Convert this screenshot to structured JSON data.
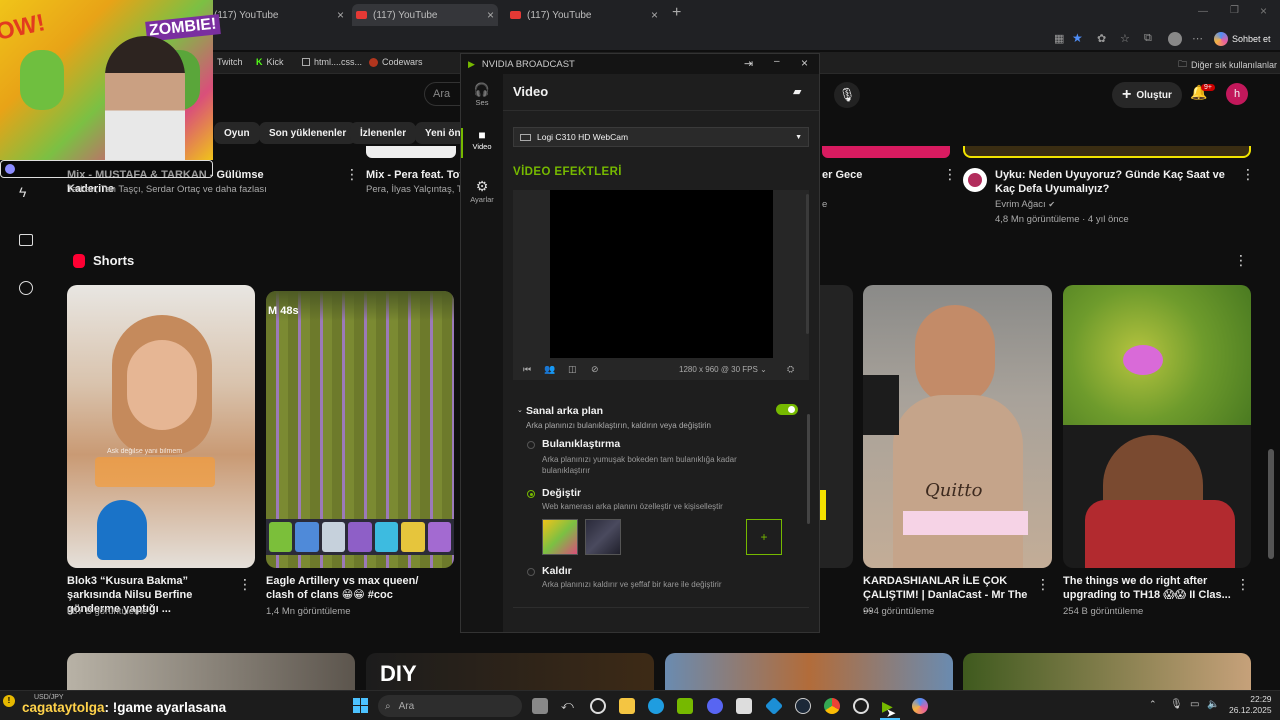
{
  "browser": {
    "tabs": [
      {
        "label": "(117) YouTube"
      },
      {
        "label": "(117) YouTube"
      },
      {
        "label": "(117) YouTube"
      }
    ],
    "new_tab": "+",
    "chat_label": "Sohbet et",
    "other_bookmarks": "Diğer sık kullanılanlar",
    "bookmarks": [
      "Twitch",
      "Kick",
      "html....css...",
      "Codewars"
    ]
  },
  "youtube": {
    "search_placeholder": "Ara",
    "create_label": "Oluştur",
    "notif_count": "9+",
    "avatar_letter": "h",
    "chips": [
      "Oyun",
      "Son yüklenenler",
      "İzlenenler",
      "Yeni öne"
    ],
    "top_videos": [
      {
        "title": "Mix - MUSTAFA & TARKAN - Gülümse Kaderine",
        "meta": "Tarkan, Tan Taşçı, Serdar Ortaç ve daha fazlası"
      },
      {
        "title": "Mix - Pera feat. Toy",
        "meta": "Pera, İlyas Yalçıntaş, To"
      },
      {
        "title": "er Gece",
        "meta": "e"
      },
      {
        "title": "Uyku: Neden Uyuyoruz? Günde Kaç Saat ve Kaç Defa Uyumalıyız?",
        "channel": "Evrim Ağacı",
        "meta": "4,8 Mn görüntüleme · 4 yıl önce"
      }
    ],
    "shorts_label": "Shorts",
    "shorts": [
      {
        "title": "Blok3 “Kusura Bakma” şarkısında Nilsu Berfine gönderme yaptığı ...",
        "views": "887 B görüntüleme",
        "caption": "Ask değilse yani bilmem"
      },
      {
        "title": "Eagle Artillery vs max queen/ clash of clans 😁😁 #coc",
        "views": "1,4 Mn görüntüleme",
        "timer": "M 48s"
      },
      {
        "title": "KARDASHIANLAR İLE ÇOK ÇALIŞTIM! | DanlaCast - Mr The ...",
        "views": "994 görüntüleme",
        "shirt": "Quitto"
      },
      {
        "title": "The things we do right after upgrading to TH18 😱😱 II Clas...",
        "views": "254 B görüntüleme"
      }
    ],
    "bottom_row": [
      "DIY"
    ]
  },
  "nvidia": {
    "app_title": "NVIDIA BROADCAST",
    "sidebar": [
      {
        "label": "Ses",
        "icon": "headset-icon"
      },
      {
        "label": "Video",
        "icon": "camera-icon"
      },
      {
        "label": "Ayarlar",
        "icon": "gear-icon"
      }
    ],
    "page_title": "Video",
    "camera_device": "Logi C310 HD WebCam",
    "effects_heading": "VİDEO EFEKTLERİ",
    "resolution": "1280 x 960 @ 30 FPS",
    "virtual_bg": {
      "title": "Sanal arka plan",
      "desc": "Arka planınızı bulanıklaştırın, kaldırın veya değiştirin",
      "enabled": true,
      "options": [
        {
          "label": "Bulanıklaştırma",
          "desc": "Arka planınızı yumuşak bokeden tam bulanıklığa kadar bulanıklaştırır",
          "selected": false
        },
        {
          "label": "Değiştir",
          "desc": "Web kamerası arka planını özelleştir ve kişiselleştir",
          "selected": true
        },
        {
          "label": "Kaldır",
          "desc": "Arka planınızı kaldırır ve şeffaf bir kare ile değiştirir",
          "selected": false
        }
      ],
      "add_label": "+"
    },
    "accent": "#76b900"
  },
  "stream": {
    "ticker": "USD/JPY",
    "chat_user": "cagataytolga",
    "chat_message": ": !game ayarlasana",
    "overlay_tag": "ZOMBIE!",
    "overlay_tag2": "OW!"
  },
  "taskbar": {
    "search_placeholder": "Ara",
    "time": "22:29",
    "date": "26.12.2025"
  }
}
